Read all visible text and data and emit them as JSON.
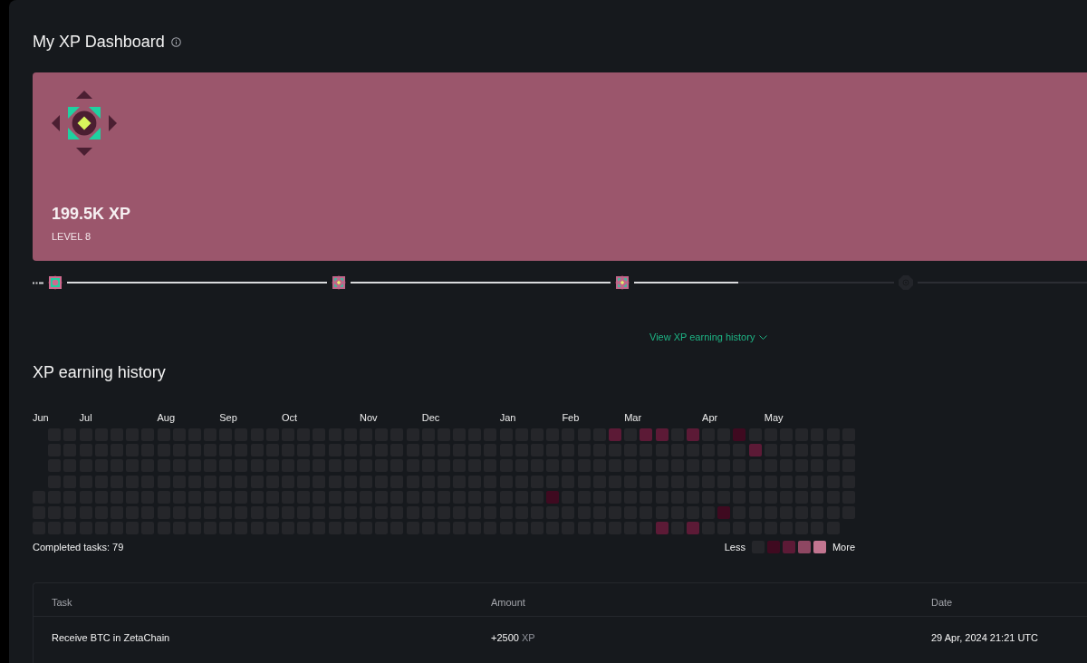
{
  "page": {
    "title": "My XP Dashboard"
  },
  "xp_card": {
    "xp": "199.5K XP",
    "level_label": "LEVEL 8"
  },
  "level_track": {
    "milestones": [
      {
        "kind": "core",
        "reached": true
      },
      {
        "kind": "diamond",
        "reached": true
      },
      {
        "kind": "diamond",
        "reached": true
      },
      {
        "kind": "diamond",
        "reached": false
      }
    ],
    "segments": [
      {
        "level": 1
      },
      {
        "level": 1
      },
      {
        "level": 0.4
      },
      {
        "level": 0
      }
    ]
  },
  "history_toggle": {
    "label": "View XP earning history"
  },
  "history": {
    "title": "XP earning history",
    "weeks": [
      {
        "month": "Jun",
        "days": [
          {
            "color": "#25262a"
          },
          {
            "color": "#25262a"
          },
          {
            "color": "#25262a"
          }
        ]
      },
      {
        "days": [
          {
            "color": "#25262a"
          },
          {
            "color": "#25262a"
          },
          {
            "color": "#25262a"
          },
          {
            "color": "#25262a"
          },
          {
            "color": "#25262a"
          },
          {
            "color": "#25262a"
          },
          {
            "color": "#25262a"
          }
        ]
      },
      {
        "days": [
          {
            "color": "#25262a"
          },
          {
            "color": "#25262a"
          },
          {
            "color": "#25262a"
          },
          {
            "color": "#25262a"
          },
          {
            "color": "#25262a"
          },
          {
            "color": "#25262a"
          },
          {
            "color": "#25262a"
          }
        ]
      },
      {
        "month": "Jul",
        "days": [
          {
            "color": "#25262a"
          },
          {
            "color": "#25262a"
          },
          {
            "color": "#25262a"
          },
          {
            "color": "#25262a"
          },
          {
            "color": "#25262a"
          },
          {
            "color": "#25262a"
          },
          {
            "color": "#25262a"
          }
        ]
      },
      {
        "days": [
          {
            "color": "#25262a"
          },
          {
            "color": "#25262a"
          },
          {
            "color": "#25262a"
          },
          {
            "color": "#25262a"
          },
          {
            "color": "#25262a"
          },
          {
            "color": "#25262a"
          },
          {
            "color": "#25262a"
          }
        ]
      },
      {
        "days": [
          {
            "color": "#25262a"
          },
          {
            "color": "#25262a"
          },
          {
            "color": "#25262a"
          },
          {
            "color": "#25262a"
          },
          {
            "color": "#25262a"
          },
          {
            "color": "#25262a"
          },
          {
            "color": "#25262a"
          }
        ]
      },
      {
        "days": [
          {
            "color": "#25262a"
          },
          {
            "color": "#25262a"
          },
          {
            "color": "#25262a"
          },
          {
            "color": "#25262a"
          },
          {
            "color": "#25262a"
          },
          {
            "color": "#25262a"
          },
          {
            "color": "#25262a"
          }
        ]
      },
      {
        "days": [
          {
            "color": "#25262a"
          },
          {
            "color": "#25262a"
          },
          {
            "color": "#25262a"
          },
          {
            "color": "#25262a"
          },
          {
            "color": "#25262a"
          },
          {
            "color": "#25262a"
          },
          {
            "color": "#25262a"
          }
        ]
      },
      {
        "month": "Aug",
        "days": [
          {
            "color": "#25262a"
          },
          {
            "color": "#25262a"
          },
          {
            "color": "#25262a"
          },
          {
            "color": "#25262a"
          },
          {
            "color": "#25262a"
          },
          {
            "color": "#25262a"
          },
          {
            "color": "#25262a"
          }
        ]
      },
      {
        "days": [
          {
            "color": "#25262a"
          },
          {
            "color": "#25262a"
          },
          {
            "color": "#25262a"
          },
          {
            "color": "#25262a"
          },
          {
            "color": "#25262a"
          },
          {
            "color": "#25262a"
          },
          {
            "color": "#25262a"
          }
        ]
      },
      {
        "days": [
          {
            "color": "#25262a"
          },
          {
            "color": "#25262a"
          },
          {
            "color": "#25262a"
          },
          {
            "color": "#25262a"
          },
          {
            "color": "#25262a"
          },
          {
            "color": "#25262a"
          },
          {
            "color": "#25262a"
          }
        ]
      },
      {
        "days": [
          {
            "color": "#25262a"
          },
          {
            "color": "#25262a"
          },
          {
            "color": "#25262a"
          },
          {
            "color": "#25262a"
          },
          {
            "color": "#25262a"
          },
          {
            "color": "#25262a"
          },
          {
            "color": "#25262a"
          }
        ]
      },
      {
        "month": "Sep",
        "days": [
          {
            "color": "#25262a"
          },
          {
            "color": "#25262a"
          },
          {
            "color": "#25262a"
          },
          {
            "color": "#25262a"
          },
          {
            "color": "#25262a"
          },
          {
            "color": "#25262a"
          },
          {
            "color": "#25262a"
          }
        ]
      },
      {
        "days": [
          {
            "color": "#25262a"
          },
          {
            "color": "#25262a"
          },
          {
            "color": "#25262a"
          },
          {
            "color": "#25262a"
          },
          {
            "color": "#25262a"
          },
          {
            "color": "#25262a"
          },
          {
            "color": "#25262a"
          }
        ]
      },
      {
        "days": [
          {
            "color": "#25262a"
          },
          {
            "color": "#25262a"
          },
          {
            "color": "#25262a"
          },
          {
            "color": "#25262a"
          },
          {
            "color": "#25262a"
          },
          {
            "color": "#25262a"
          },
          {
            "color": "#25262a"
          }
        ]
      },
      {
        "days": [
          {
            "color": "#25262a"
          },
          {
            "color": "#25262a"
          },
          {
            "color": "#25262a"
          },
          {
            "color": "#25262a"
          },
          {
            "color": "#25262a"
          },
          {
            "color": "#25262a"
          },
          {
            "color": "#25262a"
          }
        ]
      },
      {
        "month": "Oct",
        "days": [
          {
            "color": "#25262a"
          },
          {
            "color": "#25262a"
          },
          {
            "color": "#25262a"
          },
          {
            "color": "#25262a"
          },
          {
            "color": "#25262a"
          },
          {
            "color": "#25262a"
          },
          {
            "color": "#25262a"
          }
        ]
      },
      {
        "days": [
          {
            "color": "#25262a"
          },
          {
            "color": "#25262a"
          },
          {
            "color": "#25262a"
          },
          {
            "color": "#25262a"
          },
          {
            "color": "#25262a"
          },
          {
            "color": "#25262a"
          },
          {
            "color": "#25262a"
          }
        ]
      },
      {
        "days": [
          {
            "color": "#25262a"
          },
          {
            "color": "#25262a"
          },
          {
            "color": "#25262a"
          },
          {
            "color": "#25262a"
          },
          {
            "color": "#25262a"
          },
          {
            "color": "#25262a"
          },
          {
            "color": "#25262a"
          }
        ]
      },
      {
        "days": [
          {
            "color": "#25262a"
          },
          {
            "color": "#25262a"
          },
          {
            "color": "#25262a"
          },
          {
            "color": "#25262a"
          },
          {
            "color": "#25262a"
          },
          {
            "color": "#25262a"
          },
          {
            "color": "#25262a"
          }
        ]
      },
      {
        "days": [
          {
            "color": "#25262a"
          },
          {
            "color": "#25262a"
          },
          {
            "color": "#25262a"
          },
          {
            "color": "#25262a"
          },
          {
            "color": "#25262a"
          },
          {
            "color": "#25262a"
          },
          {
            "color": "#25262a"
          }
        ]
      },
      {
        "month": "Nov",
        "days": [
          {
            "color": "#25262a"
          },
          {
            "color": "#25262a"
          },
          {
            "color": "#25262a"
          },
          {
            "color": "#25262a"
          },
          {
            "color": "#25262a"
          },
          {
            "color": "#25262a"
          },
          {
            "color": "#25262a"
          }
        ]
      },
      {
        "days": [
          {
            "color": "#25262a"
          },
          {
            "color": "#25262a"
          },
          {
            "color": "#25262a"
          },
          {
            "color": "#25262a"
          },
          {
            "color": "#25262a"
          },
          {
            "color": "#25262a"
          },
          {
            "color": "#25262a"
          }
        ]
      },
      {
        "days": [
          {
            "color": "#25262a"
          },
          {
            "color": "#25262a"
          },
          {
            "color": "#25262a"
          },
          {
            "color": "#25262a"
          },
          {
            "color": "#25262a"
          },
          {
            "color": "#25262a"
          },
          {
            "color": "#25262a"
          }
        ]
      },
      {
        "days": [
          {
            "color": "#25262a"
          },
          {
            "color": "#25262a"
          },
          {
            "color": "#25262a"
          },
          {
            "color": "#25262a"
          },
          {
            "color": "#25262a"
          },
          {
            "color": "#25262a"
          },
          {
            "color": "#25262a"
          }
        ]
      },
      {
        "month": "Dec",
        "days": [
          {
            "color": "#25262a"
          },
          {
            "color": "#25262a"
          },
          {
            "color": "#25262a"
          },
          {
            "color": "#25262a"
          },
          {
            "color": "#25262a"
          },
          {
            "color": "#25262a"
          },
          {
            "color": "#25262a"
          }
        ]
      },
      {
        "days": [
          {
            "color": "#25262a"
          },
          {
            "color": "#25262a"
          },
          {
            "color": "#25262a"
          },
          {
            "color": "#25262a"
          },
          {
            "color": "#25262a"
          },
          {
            "color": "#25262a"
          },
          {
            "color": "#25262a"
          }
        ]
      },
      {
        "days": [
          {
            "color": "#25262a"
          },
          {
            "color": "#25262a"
          },
          {
            "color": "#25262a"
          },
          {
            "color": "#25262a"
          },
          {
            "color": "#25262a"
          },
          {
            "color": "#25262a"
          },
          {
            "color": "#25262a"
          }
        ]
      },
      {
        "days": [
          {
            "color": "#25262a"
          },
          {
            "color": "#25262a"
          },
          {
            "color": "#25262a"
          },
          {
            "color": "#25262a"
          },
          {
            "color": "#25262a"
          },
          {
            "color": "#25262a"
          },
          {
            "color": "#25262a"
          }
        ]
      },
      {
        "days": [
          {
            "color": "#25262a"
          },
          {
            "color": "#25262a"
          },
          {
            "color": "#25262a"
          },
          {
            "color": "#25262a"
          },
          {
            "color": "#25262a"
          },
          {
            "color": "#25262a"
          },
          {
            "color": "#25262a"
          }
        ]
      },
      {
        "month": "Jan",
        "days": [
          {
            "color": "#25262a"
          },
          {
            "color": "#25262a"
          },
          {
            "color": "#25262a"
          },
          {
            "color": "#25262a"
          },
          {
            "color": "#25262a"
          },
          {
            "color": "#25262a"
          },
          {
            "color": "#25262a"
          }
        ]
      },
      {
        "days": [
          {
            "color": "#25262a"
          },
          {
            "color": "#25262a"
          },
          {
            "color": "#25262a"
          },
          {
            "color": "#25262a"
          },
          {
            "color": "#25262a"
          },
          {
            "color": "#25262a"
          },
          {
            "color": "#25262a"
          }
        ]
      },
      {
        "days": [
          {
            "color": "#25262a"
          },
          {
            "color": "#25262a"
          },
          {
            "color": "#25262a"
          },
          {
            "color": "#25262a"
          },
          {
            "color": "#25262a"
          },
          {
            "color": "#25262a"
          },
          {
            "color": "#25262a"
          }
        ]
      },
      {
        "days": [
          {
            "color": "#25262a"
          },
          {
            "color": "#25262a"
          },
          {
            "color": "#25262a"
          },
          {
            "color": "#25262a"
          },
          {
            "color": "#3f0a20"
          },
          {
            "color": "#25262a"
          },
          {
            "color": "#25262a"
          }
        ]
      },
      {
        "month": "Feb",
        "days": [
          {
            "color": "#25262a"
          },
          {
            "color": "#25262a"
          },
          {
            "color": "#25262a"
          },
          {
            "color": "#25262a"
          },
          {
            "color": "#25262a"
          },
          {
            "color": "#25262a"
          },
          {
            "color": "#25262a"
          }
        ]
      },
      {
        "days": [
          {
            "color": "#25262a"
          },
          {
            "color": "#25262a"
          },
          {
            "color": "#25262a"
          },
          {
            "color": "#25262a"
          },
          {
            "color": "#25262a"
          },
          {
            "color": "#25262a"
          },
          {
            "color": "#25262a"
          }
        ]
      },
      {
        "days": [
          {
            "color": "#25262a"
          },
          {
            "color": "#25262a"
          },
          {
            "color": "#25262a"
          },
          {
            "color": "#25262a"
          },
          {
            "color": "#25262a"
          },
          {
            "color": "#25262a"
          },
          {
            "color": "#25262a"
          }
        ]
      },
      {
        "days": [
          {
            "color": "#5c1a36"
          },
          {
            "color": "#25262a"
          },
          {
            "color": "#25262a"
          },
          {
            "color": "#25262a"
          },
          {
            "color": "#25262a"
          },
          {
            "color": "#25262a"
          },
          {
            "color": "#25262a"
          }
        ]
      },
      {
        "month": "Mar",
        "days": [
          {
            "color": "#25262a"
          },
          {
            "color": "#25262a"
          },
          {
            "color": "#25262a"
          },
          {
            "color": "#25262a"
          },
          {
            "color": "#25262a"
          },
          {
            "color": "#25262a"
          },
          {
            "color": "#25262a"
          }
        ]
      },
      {
        "days": [
          {
            "color": "#5c1a36"
          },
          {
            "color": "#25262a"
          },
          {
            "color": "#25262a"
          },
          {
            "color": "#25262a"
          },
          {
            "color": "#25262a"
          },
          {
            "color": "#25262a"
          },
          {
            "color": "#25262a"
          }
        ]
      },
      {
        "days": [
          {
            "color": "#5c1a36"
          },
          {
            "color": "#25262a"
          },
          {
            "color": "#25262a"
          },
          {
            "color": "#25262a"
          },
          {
            "color": "#25262a"
          },
          {
            "color": "#25262a"
          },
          {
            "color": "#5c1a36"
          }
        ]
      },
      {
        "days": [
          {
            "color": "#25262a"
          },
          {
            "color": "#25262a"
          },
          {
            "color": "#25262a"
          },
          {
            "color": "#25262a"
          },
          {
            "color": "#25262a"
          },
          {
            "color": "#25262a"
          },
          {
            "color": "#25262a"
          }
        ]
      },
      {
        "days": [
          {
            "color": "#5c1a36"
          },
          {
            "color": "#25262a"
          },
          {
            "color": "#25262a"
          },
          {
            "color": "#25262a"
          },
          {
            "color": "#25262a"
          },
          {
            "color": "#25262a"
          },
          {
            "color": "#5c1a36"
          }
        ]
      },
      {
        "month": "Apr",
        "days": [
          {
            "color": "#25262a"
          },
          {
            "color": "#25262a"
          },
          {
            "color": "#25262a"
          },
          {
            "color": "#25262a"
          },
          {
            "color": "#25262a"
          },
          {
            "color": "#25262a"
          },
          {
            "color": "#25262a"
          }
        ]
      },
      {
        "days": [
          {
            "color": "#25262a"
          },
          {
            "color": "#25262a"
          },
          {
            "color": "#25262a"
          },
          {
            "color": "#25262a"
          },
          {
            "color": "#25262a"
          },
          {
            "color": "#3f0a20"
          },
          {
            "color": "#25262a"
          }
        ]
      },
      {
        "days": [
          {
            "color": "#3f0a20"
          },
          {
            "color": "#25262a"
          },
          {
            "color": "#25262a"
          },
          {
            "color": "#25262a"
          },
          {
            "color": "#25262a"
          },
          {
            "color": "#25262a"
          },
          {
            "color": "#25262a"
          }
        ]
      },
      {
        "days": [
          {
            "color": "#25262a"
          },
          {
            "color": "#5c1a36"
          },
          {
            "color": "#25262a"
          },
          {
            "color": "#25262a"
          },
          {
            "color": "#25262a"
          },
          {
            "color": "#25262a"
          },
          {
            "color": "#25262a"
          }
        ]
      },
      {
        "month": "May",
        "days": [
          {
            "color": "#25262a"
          },
          {
            "color": "#25262a"
          },
          {
            "color": "#25262a"
          },
          {
            "color": "#25262a"
          },
          {
            "color": "#25262a"
          },
          {
            "color": "#25262a"
          },
          {
            "color": "#25262a"
          }
        ]
      },
      {
        "days": [
          {
            "color": "#25262a"
          },
          {
            "color": "#25262a"
          },
          {
            "color": "#25262a"
          },
          {
            "color": "#25262a"
          },
          {
            "color": "#25262a"
          },
          {
            "color": "#25262a"
          },
          {
            "color": "#25262a"
          }
        ]
      },
      {
        "days": [
          {
            "color": "#25262a"
          },
          {
            "color": "#25262a"
          },
          {
            "color": "#25262a"
          },
          {
            "color": "#25262a"
          },
          {
            "color": "#25262a"
          },
          {
            "color": "#25262a"
          },
          {
            "color": "#25262a"
          }
        ]
      },
      {
        "days": [
          {
            "color": "#25262a"
          },
          {
            "color": "#25262a"
          },
          {
            "color": "#25262a"
          },
          {
            "color": "#25262a"
          },
          {
            "color": "#25262a"
          },
          {
            "color": "#25262a"
          },
          {
            "color": "#25262a"
          }
        ]
      },
      {
        "days": [
          {
            "color": "#25262a"
          },
          {
            "color": "#25262a"
          },
          {
            "color": "#25262a"
          },
          {
            "color": "#25262a"
          },
          {
            "color": "#25262a"
          },
          {
            "color": "#25262a"
          },
          {
            "color": "#25262a"
          }
        ]
      },
      {
        "days": [
          {
            "color": "#25262a"
          },
          {
            "color": "#25262a"
          },
          {
            "color": "#25262a"
          },
          {
            "color": "#25262a"
          },
          {
            "color": "#25262a"
          },
          {
            "color": "#25262a"
          }
        ]
      }
    ],
    "completed": "Completed tasks: 79",
    "legend": {
      "less": "Less",
      "more": "More",
      "swatches": [
        {
          "color": "#25262a"
        },
        {
          "color": "#3f0a20"
        },
        {
          "color": "#5c1a36"
        },
        {
          "color": "#8e4762"
        },
        {
          "color": "#c27590"
        }
      ]
    }
  },
  "table": {
    "columns": [
      "Task",
      "Amount",
      "Date"
    ],
    "rows": [
      {
        "task": "Receive BTC in ZetaChain",
        "amount": "+2500",
        "unit": "XP",
        "date": "29 Apr, 2024 21:21 UTC"
      }
    ]
  }
}
